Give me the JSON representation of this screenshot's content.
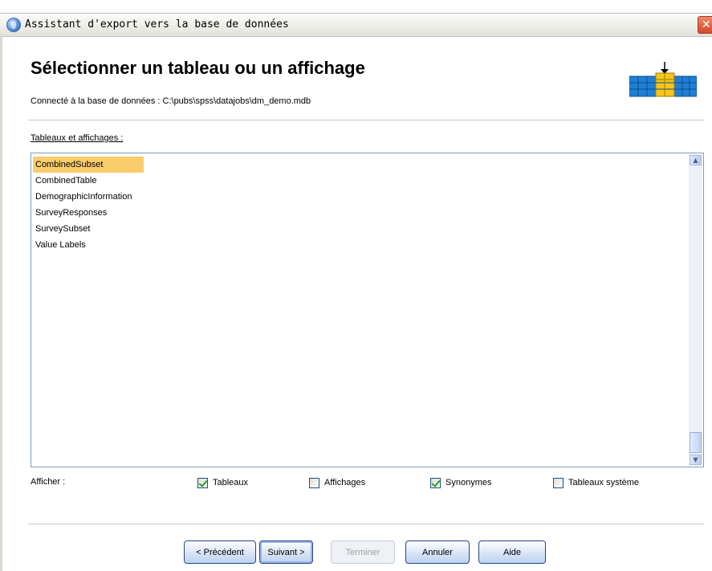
{
  "window": {
    "title": "Assistant d'export vers la base de données",
    "close_label": "✕",
    "app_icon": "database-wizard-icon"
  },
  "header": {
    "heading": "Sélectionner un tableau ou un affichage",
    "subtitle": "Connecté à la base de données : C:\\pubs\\spss\\datajobs\\dm_demo.mdb",
    "icon": "database-table-export-icon"
  },
  "list": {
    "label": "Tableaux et affichages :",
    "items": [
      {
        "label": "CombinedSubset",
        "selected": true
      },
      {
        "label": "CombinedTable",
        "selected": false
      },
      {
        "label": "DemographicInformation",
        "selected": false
      },
      {
        "label": "SurveyResponses",
        "selected": false
      },
      {
        "label": "SurveySubset",
        "selected": false
      },
      {
        "label": "Value Labels",
        "selected": false
      }
    ]
  },
  "show": {
    "label": "Afficher :",
    "options": [
      {
        "label": "Tableaux",
        "checked": true
      },
      {
        "label": "Affichages",
        "checked": false
      },
      {
        "label": "Synonymes",
        "checked": true
      },
      {
        "label": "Tableaux système",
        "checked": false
      }
    ]
  },
  "buttons": {
    "previous": "< Précédent",
    "next": "Suivant >",
    "finish": "Terminer",
    "cancel": "Annuler",
    "help": "Aide"
  },
  "colors": {
    "selection": "#f9cc6c",
    "icon_blue": "#1f7fd4",
    "icon_yellow": "#f5c518"
  }
}
